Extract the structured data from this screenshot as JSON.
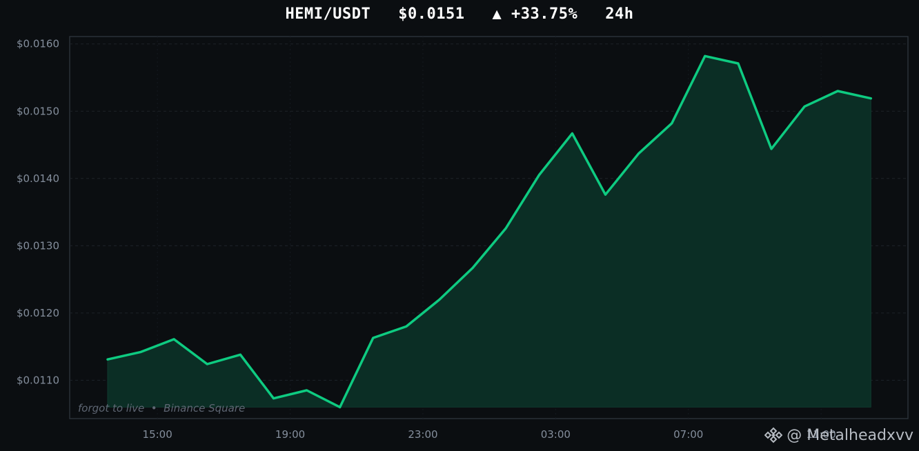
{
  "header": {
    "pair": "HEMI/USDT",
    "price": "$0.0151",
    "change": "▲ +33.75%",
    "period": "24h"
  },
  "caption": "forgot to live  •  Binance Square",
  "watermark": {
    "handle": "@ Metalheadxvv",
    "icon": "binance-logo-icon"
  },
  "colors": {
    "background": "#0b0e11",
    "line": "#0ecb81",
    "fill": "#0b2e25",
    "grid": "#1e2329",
    "axis": "#2b3139"
  },
  "chart_data": {
    "type": "area",
    "title": "",
    "xlabel": "",
    "ylabel": "",
    "ylim": [
      0.01043,
      0.01611
    ],
    "yticks": [
      0.011,
      0.012,
      0.013,
      0.014,
      0.015,
      0.016
    ],
    "ytick_labels": [
      "$0.0110",
      "$0.0120",
      "$0.0130",
      "$0.0140",
      "$0.0150",
      "$0.0160"
    ],
    "xtick_labels": [
      "15:00",
      "19:00",
      "23:00",
      "03:00",
      "07:00",
      "11:00"
    ],
    "xtick_index": [
      1.5,
      5.5,
      9.5,
      13.5,
      17.5,
      21.5
    ],
    "x": [
      "13:00",
      "14:00",
      "15:00",
      "16:00",
      "17:00",
      "18:00",
      "19:00",
      "20:00",
      "21:00",
      "22:00",
      "23:00",
      "00:00",
      "01:00",
      "02:00",
      "03:00",
      "04:00",
      "05:00",
      "06:00",
      "07:00",
      "08:00",
      "09:00",
      "10:00",
      "11:00",
      "12:00"
    ],
    "values": [
      0.01131,
      0.01142,
      0.01161,
      0.01124,
      0.01138,
      0.01073,
      0.01085,
      0.0106,
      0.01163,
      0.0118,
      0.0122,
      0.01267,
      0.01326,
      0.01405,
      0.01467,
      0.01376,
      0.01437,
      0.01482,
      0.01582,
      0.01571,
      0.01444,
      0.01507,
      0.0153,
      0.01519
    ],
    "grid": true,
    "legend": "none"
  }
}
